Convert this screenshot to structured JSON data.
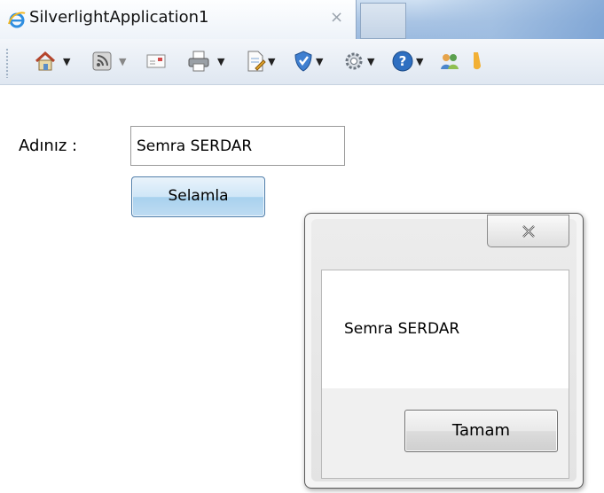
{
  "browser": {
    "tab_title": "SilverlightApplication1",
    "tab_close": "×",
    "toolbar_icons": [
      "home-icon",
      "feeds-icon",
      "read-mail-icon",
      "print-icon",
      "page-icon",
      "safety-icon",
      "tools-icon",
      "help-icon",
      "research-icon"
    ]
  },
  "page": {
    "name_label": "Adınız :",
    "name_value": "Semra SERDAR",
    "greet_button": "Selamla"
  },
  "message_box": {
    "text": "Semra SERDAR",
    "ok_button": "Tamam"
  },
  "colors": {
    "tab_strip": "#a9c4e4",
    "greet_button": "#bfdcf2",
    "ok_button": "#dcdcdc"
  }
}
